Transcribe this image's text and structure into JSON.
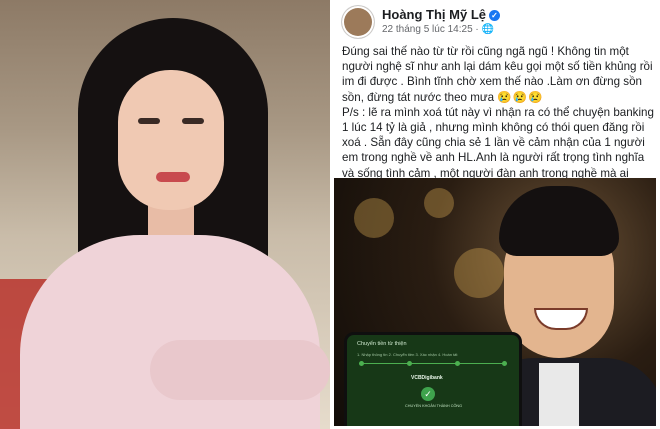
{
  "post": {
    "author_name": "Hoàng Thị Mỹ Lệ",
    "timestamp": "22 tháng 5 lúc 14:25 ·",
    "icons": {
      "verified": "verified-badge-icon",
      "audience": "globe-icon",
      "emoji": "crying-face-emoji"
    },
    "text_p1": "Đúng sai thế nào từ từ rồi cũng ngã ngũ ! Không tin một người nghệ sĩ như anh lại dám kêu gọi một số tiền khủng rồi im đi được . Bình tĩnh chờ xem thế nào .Làm ơn đừng sồn sồn, đừng tát nước theo mưa",
    "emoji_row": "😢😢😢",
    "text_p2": "P/s : lẽ ra mình xoá tút này vì nhận ra có thể chuyện banking 1 lúc 14 tỷ là giả , nhưng mình không có thói quen đăng rồi xoá . Sẵn đây cũng chia sẻ 1 lần về cảm nhận của 1 người em trong nghề về anh HL.Anh là người rất trọng tình nghĩa và sống tình cảm , một người đàn anh trong nghề mà ai cũng quý mến! Hay giúp đỡ những nghệ sĩ khác, bình dân mộc mạc, đối xử với mọi người chan hoà , vui vẻ ."
  },
  "phone_screen": {
    "title": "Chuyển tiền từ thiện",
    "steps": "1. Nhập thông tin  2. Chuyển tiền  3. Xác nhận  4. Hoàn tất",
    "bank": "VCBDigibank",
    "status": "CHUYỂN KHOẢN THÀNH CÔNG",
    "colors": {
      "screen": "#173817",
      "accent": "#4caf50"
    }
  },
  "colors": {
    "author": "#1c1e21",
    "meta": "#65676b",
    "link_blue": "#1877f2"
  }
}
